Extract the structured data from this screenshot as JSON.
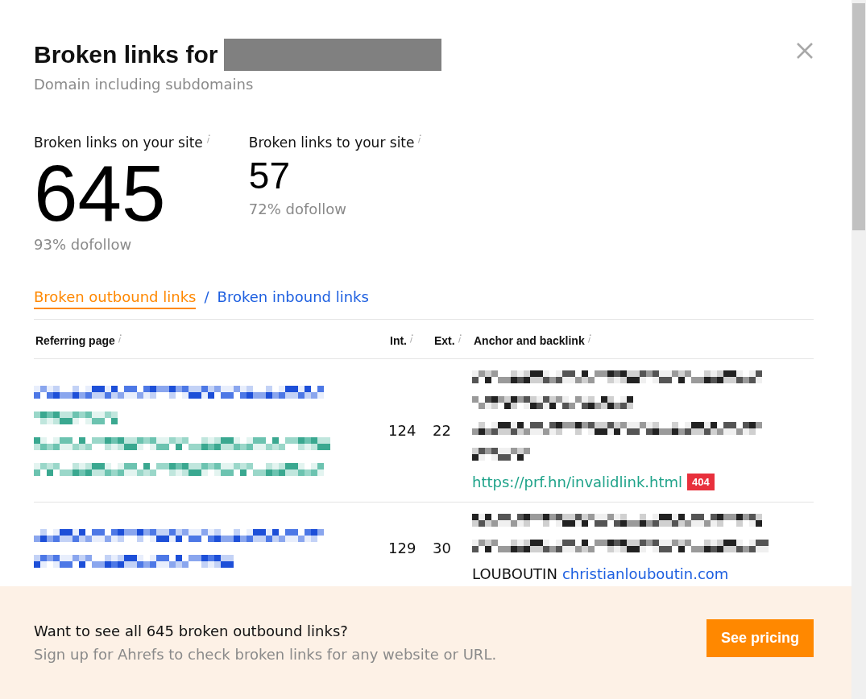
{
  "title": "Broken links for",
  "subtitle": "Domain including subdomains",
  "stats": [
    {
      "label": "Broken links on your site",
      "value": "645",
      "note": "93% dofollow",
      "kind": "large"
    },
    {
      "label": "Broken links to your site",
      "value": "57",
      "note": "72% dofollow",
      "kind": "small"
    }
  ],
  "tabs": [
    {
      "label": "Broken outbound links",
      "selected": true
    },
    {
      "label": "Broken inbound links",
      "selected": false
    }
  ],
  "tab_separator": "/",
  "table": {
    "columns": [
      {
        "label": "Referring page"
      },
      {
        "label": "Int."
      },
      {
        "label": "Ext."
      },
      {
        "label": "Anchor and backlink"
      }
    ],
    "rows": [
      {
        "int": "124",
        "ext": "22",
        "link": "https://prf.hn/invalidlink.html",
        "color": "#1fa38a",
        "status": "404"
      },
      {
        "int": "129",
        "ext": "30",
        "anchor": "LOUBOUTIN",
        "link": "christianlouboutin.com",
        "color": "#1d5fe0"
      }
    ]
  },
  "footer": {
    "headline": "Want to see all 645 broken outbound links?",
    "text": "Sign up for Ahrefs to check broken links for any website or URL.",
    "button": "See pricing"
  }
}
